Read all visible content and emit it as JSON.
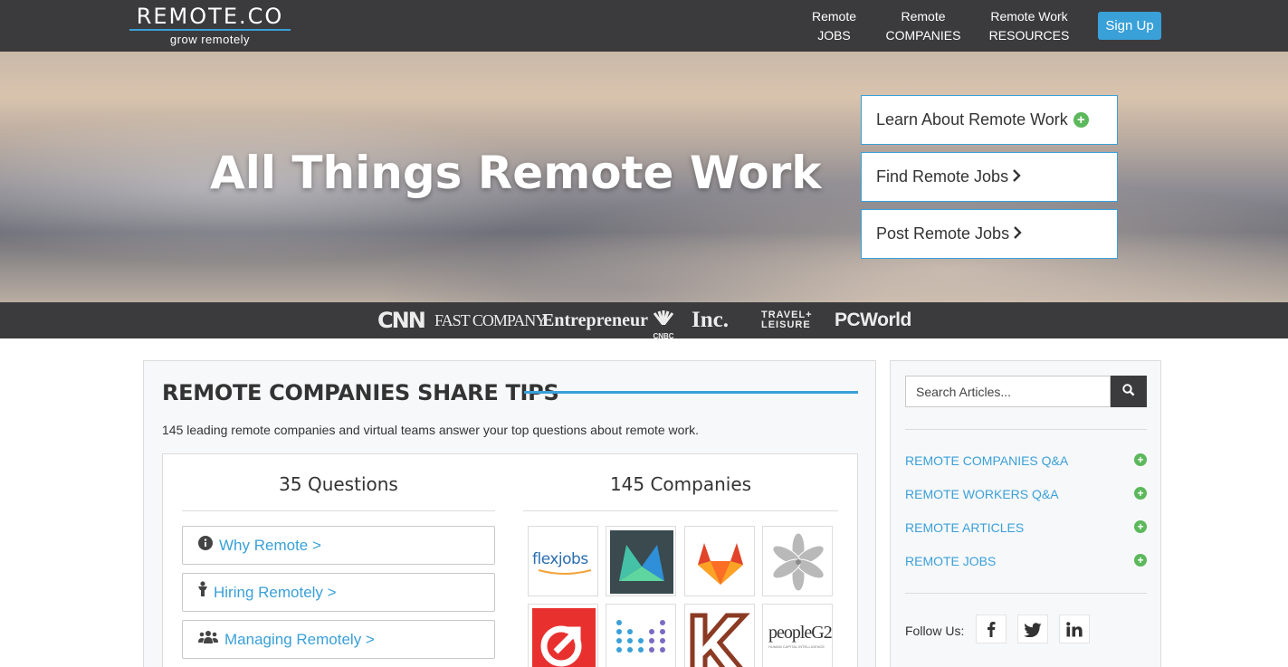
{
  "header": {
    "logo_main": "REMOTE.CO",
    "logo_tagline": "grow remotely",
    "nav": [
      {
        "line1": "Remote",
        "line2": "JOBS"
      },
      {
        "line1": "Remote",
        "line2": "COMPANIES"
      },
      {
        "line1": "Remote Work",
        "line2": "RESOURCES"
      }
    ],
    "signup_label": "Sign Up"
  },
  "hero": {
    "title": "All Things Remote Work",
    "buttons": [
      {
        "label": "Learn About Remote Work",
        "icon": "plus-circle-icon"
      },
      {
        "label": "Find Remote Jobs",
        "icon": "chevron-right-icon"
      },
      {
        "label": "Post Remote Jobs",
        "icon": "chevron-right-icon"
      }
    ]
  },
  "press_logos": [
    "CNN",
    "FAST COMPANY",
    "Entrepreneur",
    "CNBC",
    "Inc.",
    "TRAVEL+ LEISURE",
    "PCWorld"
  ],
  "main": {
    "title": "REMOTE COMPANIES SHARE TIPS",
    "intro": "145 leading remote companies and virtual teams answer your top questions about remote work.",
    "questions_heading": "35 Questions",
    "companies_heading": "145 Companies",
    "questions": [
      {
        "label": "Why Remote >",
        "icon": "info-circle-icon"
      },
      {
        "label": "Hiring Remotely >",
        "icon": "person-icon"
      },
      {
        "label": "Managing Remotely >",
        "icon": "users-icon"
      }
    ],
    "companies": [
      "flexjobs",
      "",
      "",
      "",
      "",
      "",
      "",
      "peopleG2"
    ],
    "company_logo_caption": "HUMAN CAPITAL INTELLIGENCE"
  },
  "sidebar": {
    "search_placeholder": "Search Articles...",
    "links": [
      "REMOTE COMPANIES Q&A",
      "REMOTE WORKERS Q&A",
      "REMOTE ARTICLES",
      "REMOTE JOBS"
    ],
    "follow_label": "Follow Us:",
    "social": [
      "facebook-icon",
      "twitter-icon",
      "linkedin-icon"
    ]
  },
  "colors": {
    "header_bg": "#3b3b3d",
    "accent": "#3aa0d8",
    "plus_green": "#5cb85c",
    "panel_bg": "#f7f8fa"
  }
}
